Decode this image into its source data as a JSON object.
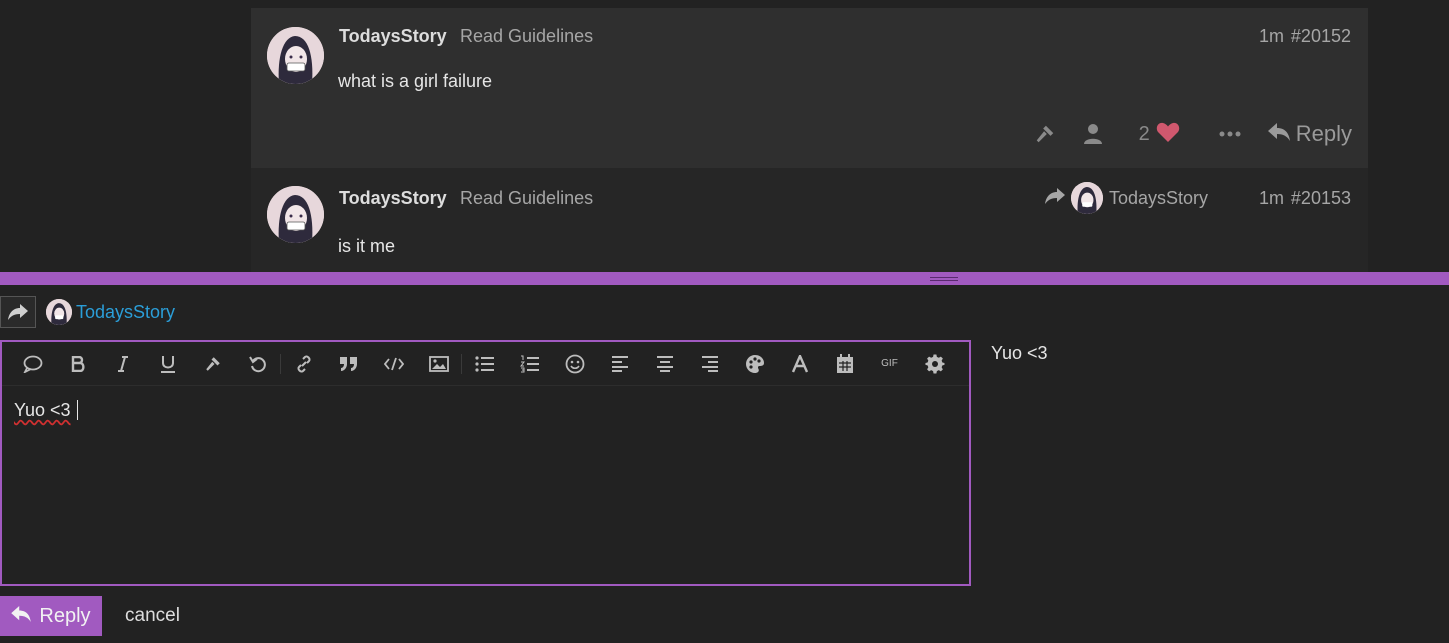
{
  "posts": [
    {
      "username": "TodaysStory",
      "badge": "Read Guidelines",
      "age": "1m",
      "number": "#20152",
      "text": "what is a girl failure",
      "likes": "2",
      "reply_label": "Reply"
    },
    {
      "username": "TodaysStory",
      "badge": "Read Guidelines",
      "reply_to": "TodaysStory",
      "age": "1m",
      "number": "#20153",
      "text": "is it me"
    }
  ],
  "composer": {
    "reply_target": "TodaysStory",
    "editor_text": "Yuo <3",
    "preview_text": "Yuo <3",
    "toolbar_icons": [
      "quote-bubble-icon",
      "bold-icon",
      "italic-icon",
      "underline-icon",
      "admin-hammer-icon",
      "undo-icon",
      "link-icon",
      "blockquote-icon",
      "code-icon",
      "image-icon",
      "bullet-list-icon",
      "numbered-list-icon",
      "emoji-icon",
      "align-left-icon",
      "align-center-icon",
      "align-right-icon",
      "color-palette-icon",
      "font-icon",
      "date-icon",
      "gif-icon",
      "settings-icon"
    ],
    "gif_label": "GIF",
    "submit_label": "Reply",
    "cancel_label": "cancel"
  },
  "colors": {
    "accent": "#a15ac0",
    "link": "#2b9ed8",
    "heart": "#d0586e"
  }
}
